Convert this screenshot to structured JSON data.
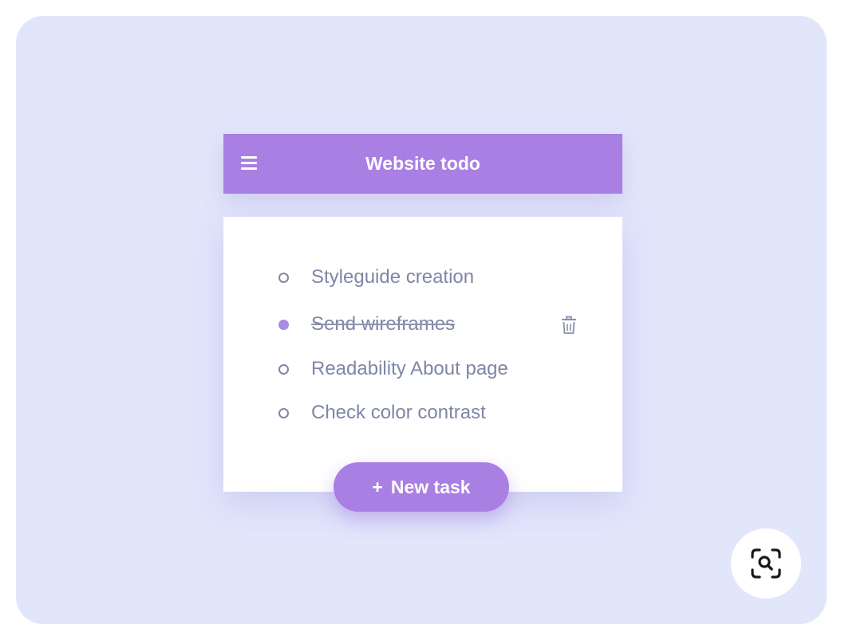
{
  "header": {
    "title": "Website todo",
    "menu_icon": "hamburger-menu-icon"
  },
  "tasks": [
    {
      "label": "Styleguide creation",
      "done": false
    },
    {
      "label": "Send wireframes",
      "done": true
    },
    {
      "label": "Readability About page",
      "done": false
    },
    {
      "label": "Check color contrast",
      "done": false
    }
  ],
  "actions": {
    "delete_icon": "trash-icon",
    "new_task_plus": "+",
    "new_task_label": "New task"
  },
  "overlay": {
    "lens_icon": "visual-search-icon"
  },
  "colors": {
    "page_background": "#e2e6fb",
    "accent": "#a97fe3",
    "text": "#7f86a6",
    "card": "#ffffff"
  }
}
